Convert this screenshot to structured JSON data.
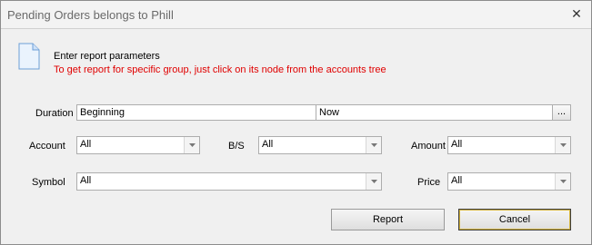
{
  "window": {
    "title": "Pending Orders belongs to Phill",
    "close_glyph": "✕"
  },
  "header": {
    "icon": "document-icon",
    "line1": "Enter report parameters",
    "line2": "To get report for specific group, just click on its node from the accounts tree",
    "line2_color": "#e00000"
  },
  "form": {
    "duration": {
      "label": "Duration",
      "from": "Beginning",
      "to": "Now",
      "button": "..."
    },
    "account": {
      "label": "Account",
      "value": "All"
    },
    "bs": {
      "label": "B/S",
      "value": "All"
    },
    "amount": {
      "label": "Amount",
      "value": "All"
    },
    "symbol": {
      "label": "Symbol",
      "value": "All"
    },
    "price": {
      "label": "Price",
      "value": "All"
    }
  },
  "buttons": {
    "report": "Report",
    "cancel": "Cancel"
  }
}
